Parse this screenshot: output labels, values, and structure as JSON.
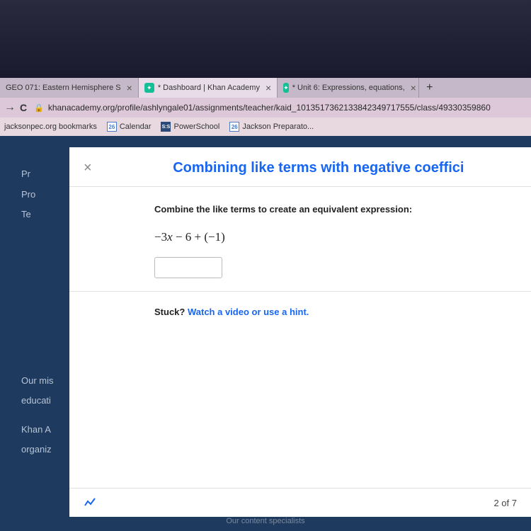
{
  "tabs": [
    {
      "title": "GEO 071: Eastern Hemisphere S"
    },
    {
      "title": "* Dashboard | Khan Academy"
    },
    {
      "title": "* Unit 6: Expressions, equations,"
    }
  ],
  "addressBar": {
    "url": "khanacademy.org/profile/ashlyngale01/assignments/teacher/kaid_1013517362133842349717555/class/49330359860"
  },
  "bookmarks": [
    {
      "label": "jacksonpec.org bookmarks"
    },
    {
      "label": "Calendar",
      "icon": "26"
    },
    {
      "label": "PowerSchool",
      "icon": "S:S"
    },
    {
      "label": "Jackson Preparato...",
      "icon": "26"
    }
  ],
  "sidebar": {
    "top": [
      "",
      "Pr",
      "Pro",
      "Te"
    ],
    "bottom": [
      "Our mis",
      "educati",
      "",
      "Khan A",
      "organiz"
    ]
  },
  "footer": "Our content specialists",
  "modal": {
    "title": "Combining like terms with negative coeffici",
    "prompt": "Combine the like terms to create an equivalent expression:",
    "expression": "−3x − 6 + (−1)",
    "answerPlaceholder": "",
    "stuckLabel": "Stuck? ",
    "hintLink": "Watch a video or use a hint.",
    "progressCurrent": "2",
    "progressTotal": "7",
    "progressOf": " of "
  }
}
